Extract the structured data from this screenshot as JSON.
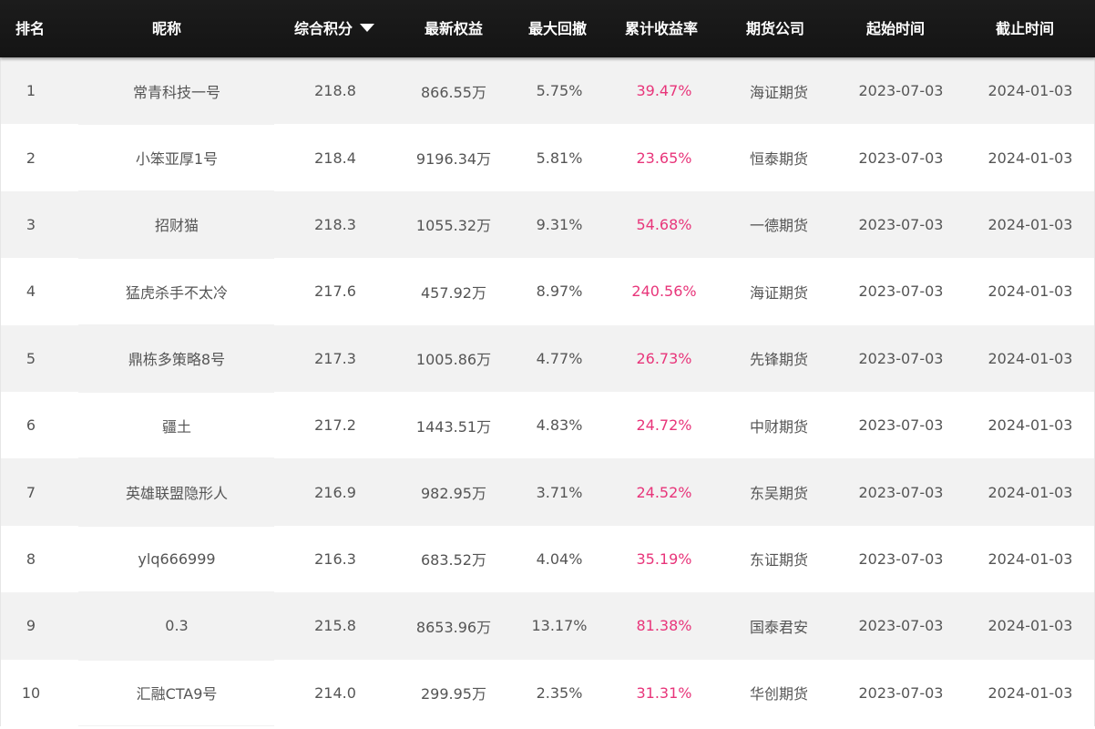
{
  "table": {
    "headers": {
      "rank": "排名",
      "nickname": "昵称",
      "score": "综合积分",
      "equity": "最新权益",
      "drawdown": "最大回撤",
      "return": "累计收益率",
      "broker": "期货公司",
      "start": "起始时间",
      "end": "截止时间"
    },
    "sort_icon": "caret-down-icon",
    "colors": {
      "header_bg": "#141414",
      "row_alt_bg": "#f2f2f2",
      "return_text": "#e8357a",
      "body_text": "#555555"
    },
    "rows": [
      {
        "rank": "1",
        "nickname": "常青科技一号",
        "score": "218.8",
        "equity": "866.55万",
        "drawdown": "5.75%",
        "return": "39.47%",
        "broker": "海证期货",
        "start": "2023-07-03",
        "end": "2024-01-03"
      },
      {
        "rank": "2",
        "nickname": "小笨亚厚1号",
        "score": "218.4",
        "equity": "9196.34万",
        "drawdown": "5.81%",
        "return": "23.65%",
        "broker": "恒泰期货",
        "start": "2023-07-03",
        "end": "2024-01-03"
      },
      {
        "rank": "3",
        "nickname": "招财猫",
        "score": "218.3",
        "equity": "1055.32万",
        "drawdown": "9.31%",
        "return": "54.68%",
        "broker": "一德期货",
        "start": "2023-07-03",
        "end": "2024-01-03"
      },
      {
        "rank": "4",
        "nickname": "猛虎杀手不太冷",
        "score": "217.6",
        "equity": "457.92万",
        "drawdown": "8.97%",
        "return": "240.56%",
        "broker": "海证期货",
        "start": "2023-07-03",
        "end": "2024-01-03"
      },
      {
        "rank": "5",
        "nickname": "鼎栋多策略8号",
        "score": "217.3",
        "equity": "1005.86万",
        "drawdown": "4.77%",
        "return": "26.73%",
        "broker": "先锋期货",
        "start": "2023-07-03",
        "end": "2024-01-03"
      },
      {
        "rank": "6",
        "nickname": "疆土",
        "score": "217.2",
        "equity": "1443.51万",
        "drawdown": "4.83%",
        "return": "24.72%",
        "broker": "中财期货",
        "start": "2023-07-03",
        "end": "2024-01-03"
      },
      {
        "rank": "7",
        "nickname": "英雄联盟隐形人",
        "score": "216.9",
        "equity": "982.95万",
        "drawdown": "3.71%",
        "return": "24.52%",
        "broker": "东吴期货",
        "start": "2023-07-03",
        "end": "2024-01-03"
      },
      {
        "rank": "8",
        "nickname": "ylq666999",
        "score": "216.3",
        "equity": "683.52万",
        "drawdown": "4.04%",
        "return": "35.19%",
        "broker": "东证期货",
        "start": "2023-07-03",
        "end": "2024-01-03"
      },
      {
        "rank": "9",
        "nickname": "0.3",
        "score": "215.8",
        "equity": "8653.96万",
        "drawdown": "13.17%",
        "return": "81.38%",
        "broker": "国泰君安",
        "start": "2023-07-03",
        "end": "2024-01-03"
      },
      {
        "rank": "10",
        "nickname": "汇融CTA9号",
        "score": "214.0",
        "equity": "299.95万",
        "drawdown": "2.35%",
        "return": "31.31%",
        "broker": "华创期货",
        "start": "2023-07-03",
        "end": "2024-01-03"
      }
    ]
  }
}
